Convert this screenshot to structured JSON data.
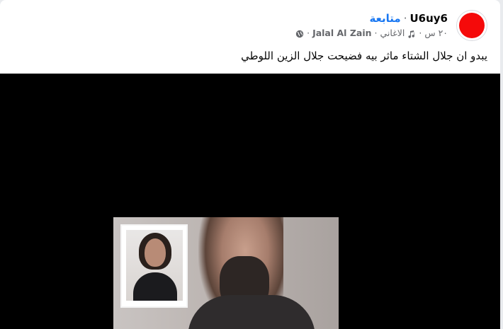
{
  "post": {
    "author": "U6uy6",
    "separator": "·",
    "follow_label": "متابعة",
    "time": "٢٠ س",
    "music_label": "الاغاني",
    "tagged": "Jalal Al Zain",
    "privacy_icon": "globe-icon",
    "caption": "يبدو ان جلال الشتاء ماثر بيه فضيحت جلال الزين اللوطي"
  },
  "colors": {
    "avatar": "#f50a0a",
    "follow": "#1877f2",
    "video_bg": "#000000"
  }
}
